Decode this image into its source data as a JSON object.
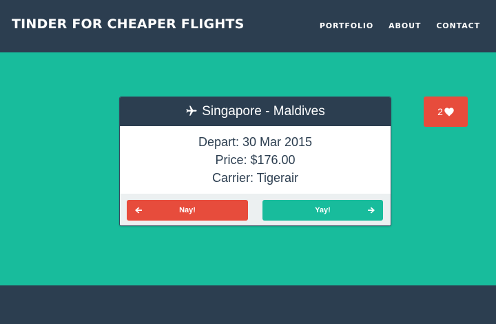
{
  "navbar": {
    "brand": "TINDER FOR CHEAPER FLIGHTS",
    "links": [
      {
        "label": "PORTFOLIO"
      },
      {
        "label": "ABOUT"
      },
      {
        "label": "CONTACT"
      }
    ]
  },
  "flight_card": {
    "route": "Singapore - Maldives",
    "icon": "plane-icon",
    "depart": "Depart: 30 Mar 2015",
    "price": "Price: $176.00",
    "carrier": "Carrier: Tigerair",
    "nay_label": "Nay!",
    "yay_label": "Yay!"
  },
  "likes": {
    "count": "2",
    "icon": "heart-icon"
  },
  "colors": {
    "navy": "#2c3e50",
    "teal": "#18bc9c",
    "red": "#e74c3c",
    "light_gray": "#ecf0f1"
  }
}
